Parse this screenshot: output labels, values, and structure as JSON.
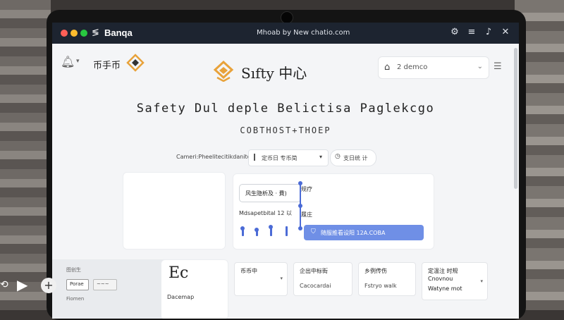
{
  "titlebar": {
    "app_name": "Banqa",
    "window_title": "Mhoab by New chatio.com",
    "icons": [
      "gear-icon",
      "menu-icon",
      "bell-icon",
      "close-icon"
    ]
  },
  "header": {
    "left_brand_text": "币手币",
    "center_title": "Sıfty 中心",
    "selector_text": "2 demco",
    "icons": [
      "bell-icon",
      "logo-diamond-icon",
      "home-icon",
      "filter-icon"
    ]
  },
  "main": {
    "heading": "Safety Dul deple Belictisa Paglekcgo",
    "subheading": "COBTHOST+THOEP",
    "category_label": "Cameri:Pheelitecitikdanitey",
    "category_select": "定币日 专币简",
    "time_range": "支日统 计",
    "panel": {
      "field_a": "风生隐析及 · 費)",
      "field_b": "Mdsapetbital  12 以",
      "mini_a": "规疗",
      "mini_b": "履庄",
      "primary_button": "随服推看设阳  12A.COBA"
    }
  },
  "bottom": {
    "strip_label": "图创生",
    "strip_button_1": "Porae",
    "strip_button_2": "~~~",
    "strip_caption": "Fiomen",
    "big_logo": "Ec",
    "big_sub": "Dacemap",
    "cards": [
      {
        "title": "币币中",
        "sub": ""
      },
      {
        "title": "企出中标街",
        "sub": "Cacocardai"
      },
      {
        "title": "乡例传伤",
        "sub": "Fstryo walk"
      },
      {
        "line1": "定温注 时规",
        "line2": "Cnovnou",
        "line3": "Watyne mot"
      }
    ]
  },
  "colors": {
    "titlebar_bg": "#1d2430",
    "accent_blue": "#6f8fe6",
    "logo_orange": "#e8a23a",
    "screen_bg": "#f4f5f7"
  }
}
